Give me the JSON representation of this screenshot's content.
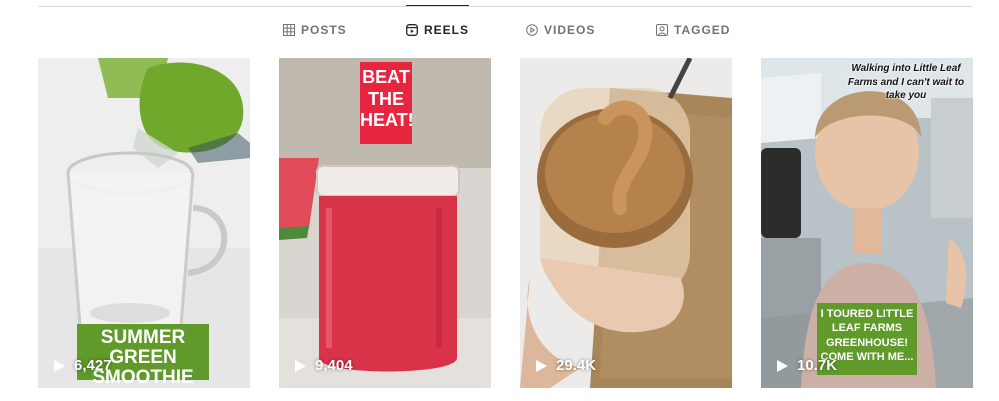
{
  "tabs": [
    {
      "label": "POSTS",
      "icon": "grid-icon",
      "active": false
    },
    {
      "label": "REELS",
      "icon": "reels-icon",
      "active": true
    },
    {
      "label": "VIDEOS",
      "icon": "video-play-icon",
      "active": false
    },
    {
      "label": "TAGGED",
      "icon": "tagged-icon",
      "active": false
    }
  ],
  "reels": [
    {
      "views": "6,427",
      "overlay": "SUMMER GREEN SMOOTHIE"
    },
    {
      "views": "9,404",
      "overlay": "BEAT\nTHE\nHEAT!"
    },
    {
      "views": "29.4K",
      "overlay": ""
    },
    {
      "views": "10.7K",
      "overlay": "I TOURED LITTLE LEAF FARMS GREENHOUSE! COME WITH ME...",
      "top_text": "Walking into Little Leaf Farms and I can't wait to take you"
    }
  ],
  "colors": {
    "caption_green": "#5f9a2a",
    "caption_red": "#e8253f",
    "active_tab": "#262626",
    "inactive_tab": "#737373"
  }
}
